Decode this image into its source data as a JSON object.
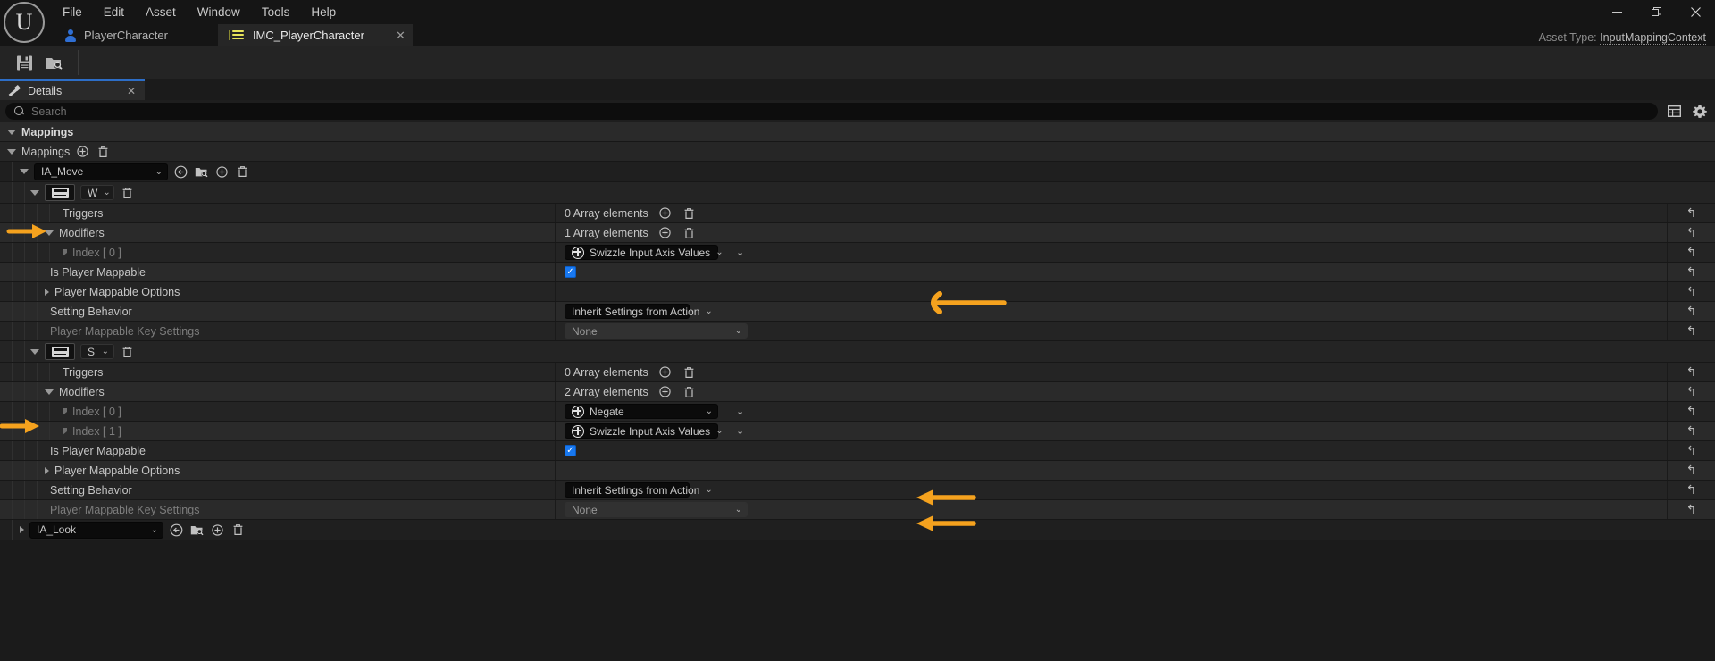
{
  "window": {
    "minimize_label": "—",
    "maximize_label": "❐",
    "close_label": "✕",
    "asset_type_prefix": "Asset Type:",
    "asset_type_value": "InputMappingContext"
  },
  "menubar": {
    "items": [
      {
        "label": "File"
      },
      {
        "label": "Edit"
      },
      {
        "label": "Asset"
      },
      {
        "label": "Window"
      },
      {
        "label": "Tools"
      },
      {
        "label": "Help"
      }
    ]
  },
  "tabs": [
    {
      "label": "PlayerCharacter",
      "icon": "person-icon",
      "active": false
    },
    {
      "label": "IMC_PlayerCharacter",
      "icon": "input-mapping-context-icon",
      "active": true,
      "close_label": "✕"
    }
  ],
  "toolbar": {
    "buttons": [
      {
        "name": "save-button",
        "icon": "save-icon"
      },
      {
        "name": "browse-button",
        "icon": "browse-content-icon"
      }
    ]
  },
  "details_panel": {
    "tab_label": "Details",
    "tab_icon": "wrench-icon",
    "tab_close_label": "✕",
    "search": {
      "placeholder": "Search",
      "value": ""
    },
    "view_options_icon": "table-view-icon",
    "settings_icon": "gear-icon"
  },
  "tree": {
    "category_label": "Mappings",
    "array_label": "Mappings",
    "add_icon": "plus-circle-icon",
    "delete_icon": "trash-icon",
    "revert_icon": "↰",
    "rows": [
      {
        "kind": "asset",
        "name": "ia-move-asset-row",
        "value": "IA_Move",
        "expanded": true,
        "icons": [
          "browse-to-asset-icon",
          "open-asset-icon",
          "add-icon",
          "delete-icon"
        ]
      },
      {
        "kind": "key",
        "name": "key-binding-w",
        "key": "W",
        "keyboard_icon": "keyboard-icon",
        "delete_icon": "trash-icon",
        "annotated": true
      },
      {
        "kind": "array",
        "name": "triggers-row",
        "label": "Triggers",
        "count": "0 Array elements",
        "expanded": false
      },
      {
        "kind": "array",
        "name": "modifiers-row",
        "label": "Modifiers",
        "count": "1 Array elements",
        "expanded": true
      },
      {
        "kind": "modifier",
        "name": "modifier-index-0",
        "label": "Index [ 0 ]",
        "value": "Swizzle Input Axis Values",
        "annotated": true
      },
      {
        "kind": "check",
        "name": "is-player-mappable-row",
        "label": "Is Player Mappable",
        "checked": true
      },
      {
        "kind": "expand",
        "name": "player-mappable-options-row",
        "label": "Player Mappable Options"
      },
      {
        "kind": "setting",
        "name": "setting-behavior-row",
        "label": "Setting Behavior",
        "value": "Inherit Settings from Action"
      },
      {
        "kind": "disabled",
        "name": "player-mappable-key-settings-row",
        "label": "Player Mappable Key Settings",
        "value": "None"
      },
      {
        "kind": "key",
        "name": "key-binding-s",
        "key": "S",
        "keyboard_icon": "keyboard-icon",
        "delete_icon": "trash-icon",
        "annotated": true
      },
      {
        "kind": "array",
        "name": "triggers-row-2",
        "label": "Triggers",
        "count": "0 Array elements",
        "expanded": false
      },
      {
        "kind": "array",
        "name": "modifiers-row-2",
        "label": "Modifiers",
        "count": "2 Array elements",
        "expanded": true
      },
      {
        "kind": "modifier",
        "name": "modifier-index-0-b",
        "label": "Index [ 0 ]",
        "value": "Negate",
        "annotated": true
      },
      {
        "kind": "modifier",
        "name": "modifier-index-1-b",
        "label": "Index [ 1 ]",
        "value": "Swizzle Input Axis Values",
        "annotated": true
      },
      {
        "kind": "check",
        "name": "is-player-mappable-row-2",
        "label": "Is Player Mappable",
        "checked": true
      },
      {
        "kind": "expand",
        "name": "player-mappable-options-row-2",
        "label": "Player Mappable Options"
      },
      {
        "kind": "setting",
        "name": "setting-behavior-row-2",
        "label": "Setting Behavior",
        "value": "Inherit Settings from Action"
      },
      {
        "kind": "disabled",
        "name": "player-mappable-key-settings-row-2",
        "label": "Player Mappable Key Settings",
        "value": "None"
      },
      {
        "kind": "asset",
        "name": "ia-look-asset-row",
        "value": "IA_Look",
        "expanded": false,
        "icons": [
          "browse-to-asset-icon",
          "open-asset-icon",
          "add-icon",
          "delete-icon"
        ]
      }
    ]
  },
  "annotations": {
    "color": "#f5a21e",
    "arrows": [
      {
        "name": "annotation-arrow-key-w",
        "target": "key-binding-w"
      },
      {
        "name": "annotation-arrow-key-s",
        "target": "key-binding-s"
      },
      {
        "name": "annotation-arrow-swizzle-1",
        "target": "modifier-index-0"
      },
      {
        "name": "annotation-arrow-negate",
        "target": "modifier-index-0-b"
      },
      {
        "name": "annotation-arrow-swizzle-2",
        "target": "modifier-index-1-b"
      }
    ]
  }
}
